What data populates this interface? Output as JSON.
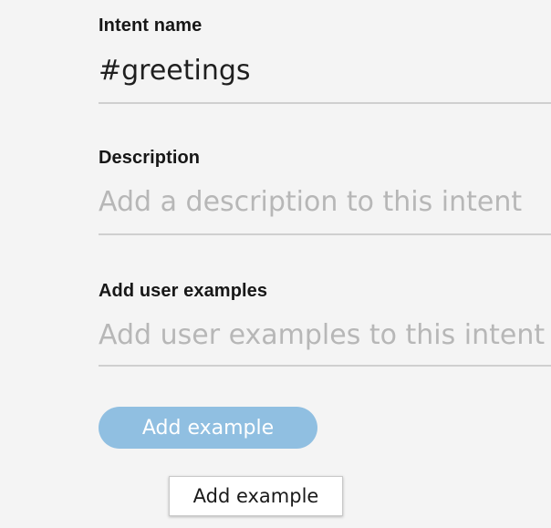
{
  "form": {
    "intent_name": {
      "label": "Intent name",
      "value": "#greetings"
    },
    "description": {
      "label": "Description",
      "placeholder": "Add a description to this intent"
    },
    "user_examples": {
      "label": "Add user examples",
      "placeholder": "Add user examples to this intent"
    },
    "add_example_button": {
      "label": "Add example"
    }
  },
  "tooltip": {
    "text": "Add example"
  },
  "colors": {
    "background": "#f4f4f4",
    "button": "#90bfe1",
    "placeholder": "#b7b7b7",
    "underline": "#cfcfcf"
  }
}
